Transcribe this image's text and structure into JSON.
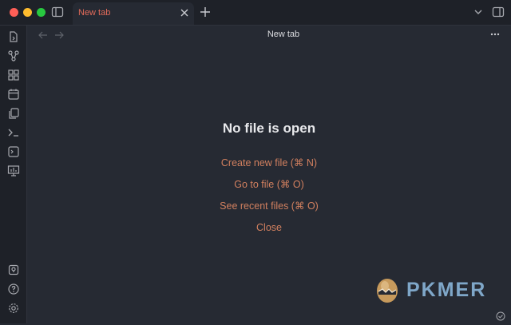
{
  "tabs": [
    {
      "label": "New tab",
      "active": true
    }
  ],
  "header": {
    "title": "New tab"
  },
  "empty_state": {
    "title": "No file is open",
    "actions": [
      {
        "label": "Create new file (⌘ N)"
      },
      {
        "label": "Go to file (⌘ O)"
      },
      {
        "label": "See recent files (⌘ O)"
      },
      {
        "label": "Close"
      }
    ]
  },
  "watermark": {
    "brand": "PKMER"
  },
  "icons": {
    "ribbon_top": [
      "file-open-icon",
      "graph-icon",
      "canvas-icon",
      "daily-note-icon",
      "copy-icon",
      "terminal-icon",
      "command-palette-icon",
      "slides-icon"
    ],
    "ribbon_bottom": [
      "vault-icon",
      "help-icon",
      "settings-icon"
    ]
  },
  "colors": {
    "accent": "#d2805f",
    "tab_label": "#e36b5a",
    "background": "#262a33",
    "sidebar": "#1e2128",
    "brand": "#7fa7c9"
  }
}
